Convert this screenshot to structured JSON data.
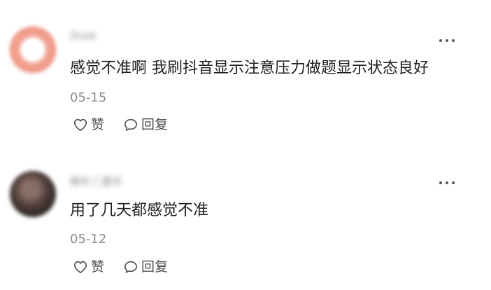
{
  "comments": [
    {
      "username": "Dusk",
      "text": "感觉不准啊 我刷抖音显示注意压力做题显示状态良好",
      "date": "05-15",
      "actions": {
        "like_label": "赞",
        "reply_label": "回复"
      }
    },
    {
      "username": "紫杉二喜乐",
      "text": "用了几天都感觉不准",
      "date": "05-12",
      "actions": {
        "like_label": "赞",
        "reply_label": "回复"
      }
    }
  ]
}
